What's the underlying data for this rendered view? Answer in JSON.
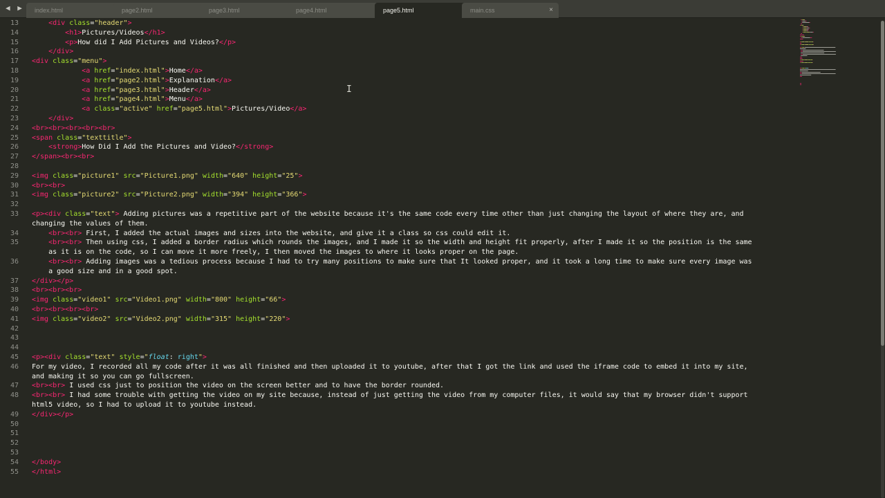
{
  "tabs": [
    {
      "label": "index.html",
      "close": "●",
      "active": false
    },
    {
      "label": "page2.html",
      "close": "●",
      "active": false
    },
    {
      "label": "page3.html",
      "close": "×",
      "active": false
    },
    {
      "label": "page4.html",
      "close": "×",
      "active": false
    },
    {
      "label": "page5.html",
      "close": "×",
      "active": true
    },
    {
      "label": "main.css",
      "close": "×",
      "active": false
    }
  ],
  "nav_arrows": "◀ ▶",
  "line_numbers": [
    "13",
    "14",
    "15",
    "16",
    "17",
    "18",
    "19",
    "20",
    "21",
    "22",
    "23",
    "24",
    "25",
    "26",
    "27",
    "28",
    "29",
    "30",
    "31",
    "32",
    "33",
    "",
    "34",
    "35",
    "",
    "36",
    "",
    "37",
    "38",
    "39",
    "40",
    "41",
    "42",
    "43",
    "44",
    "45",
    "46",
    "",
    "47",
    "48",
    "",
    "49",
    "50",
    "51",
    "52",
    "53",
    "54",
    "55"
  ],
  "code": [
    [
      [
        "p",
        "    "
      ],
      [
        "t",
        "<div"
      ],
      [
        "a",
        " class"
      ],
      [
        "p",
        "="
      ],
      [
        "s",
        "\"header\""
      ],
      [
        "t",
        ">"
      ]
    ],
    [
      [
        "p",
        "        "
      ],
      [
        "t",
        "<h1"
      ],
      [
        "t",
        ">"
      ],
      [
        "p",
        "Pictures/Videos"
      ],
      [
        "t",
        "</h1>"
      ]
    ],
    [
      [
        "p",
        "        "
      ],
      [
        "t",
        "<p"
      ],
      [
        "t",
        ">"
      ],
      [
        "p",
        "How did I Add Pictures and Videos?"
      ],
      [
        "t",
        "</p>"
      ]
    ],
    [
      [
        "p",
        "    "
      ],
      [
        "t",
        "</div>"
      ]
    ],
    [
      [
        "t",
        "<div"
      ],
      [
        "a",
        " class"
      ],
      [
        "p",
        "="
      ],
      [
        "s",
        "\"menu\""
      ],
      [
        "t",
        ">"
      ]
    ],
    [
      [
        "p",
        "            "
      ],
      [
        "t",
        "<a"
      ],
      [
        "a",
        " href"
      ],
      [
        "p",
        "="
      ],
      [
        "s",
        "\"index.html\""
      ],
      [
        "t",
        ">"
      ],
      [
        "p",
        "Home"
      ],
      [
        "t",
        "</a>"
      ]
    ],
    [
      [
        "p",
        "            "
      ],
      [
        "t",
        "<a"
      ],
      [
        "a",
        " href"
      ],
      [
        "p",
        "="
      ],
      [
        "s",
        "\"page2.html\""
      ],
      [
        "t",
        ">"
      ],
      [
        "p",
        "Explanation"
      ],
      [
        "t",
        "</a>"
      ]
    ],
    [
      [
        "p",
        "            "
      ],
      [
        "t",
        "<a"
      ],
      [
        "a",
        " href"
      ],
      [
        "p",
        "="
      ],
      [
        "s",
        "\"page3.html\""
      ],
      [
        "t",
        ">"
      ],
      [
        "p",
        "Header"
      ],
      [
        "t",
        "</a>"
      ]
    ],
    [
      [
        "p",
        "            "
      ],
      [
        "t",
        "<a"
      ],
      [
        "a",
        " href"
      ],
      [
        "p",
        "="
      ],
      [
        "s",
        "\"page4.html\""
      ],
      [
        "t",
        ">"
      ],
      [
        "p",
        "Menu"
      ],
      [
        "t",
        "</a>"
      ]
    ],
    [
      [
        "p",
        "            "
      ],
      [
        "t",
        "<a"
      ],
      [
        "a",
        " class"
      ],
      [
        "p",
        "="
      ],
      [
        "s",
        "\"active\""
      ],
      [
        "a",
        " href"
      ],
      [
        "p",
        "="
      ],
      [
        "s",
        "\"page5.html\""
      ],
      [
        "t",
        ">"
      ],
      [
        "p",
        "Pictures/Video"
      ],
      [
        "t",
        "</a>"
      ]
    ],
    [
      [
        "p",
        "    "
      ],
      [
        "t",
        "</div>"
      ]
    ],
    [
      [
        "t",
        "<br><br><br><br><br>"
      ]
    ],
    [
      [
        "t",
        "<span"
      ],
      [
        "a",
        " class"
      ],
      [
        "p",
        "="
      ],
      [
        "s",
        "\"texttitle\""
      ],
      [
        "t",
        ">"
      ]
    ],
    [
      [
        "p",
        "    "
      ],
      [
        "t",
        "<strong"
      ],
      [
        "t",
        ">"
      ],
      [
        "p",
        "How Did I Add the Pictures and Video?"
      ],
      [
        "t",
        "</strong>"
      ]
    ],
    [
      [
        "t",
        "</span><br><br>"
      ]
    ],
    [
      [
        "p",
        ""
      ]
    ],
    [
      [
        "t",
        "<img"
      ],
      [
        "a",
        " class"
      ],
      [
        "p",
        "="
      ],
      [
        "s",
        "\"picture1\""
      ],
      [
        "a",
        " src"
      ],
      [
        "p",
        "="
      ],
      [
        "s",
        "\"Picture1.png\""
      ],
      [
        "a",
        " width"
      ],
      [
        "p",
        "="
      ],
      [
        "s",
        "\"640\""
      ],
      [
        "a",
        " height"
      ],
      [
        "p",
        "="
      ],
      [
        "s",
        "\"25\""
      ],
      [
        "t",
        ">"
      ]
    ],
    [
      [
        "t",
        "<br><br>"
      ]
    ],
    [
      [
        "t",
        "<img"
      ],
      [
        "a",
        " class"
      ],
      [
        "p",
        "="
      ],
      [
        "s",
        "\"picture2\""
      ],
      [
        "a",
        " src"
      ],
      [
        "p",
        "="
      ],
      [
        "s",
        "\"Picture2.png\""
      ],
      [
        "a",
        " width"
      ],
      [
        "p",
        "="
      ],
      [
        "s",
        "\"394\""
      ],
      [
        "a",
        " height"
      ],
      [
        "p",
        "="
      ],
      [
        "s",
        "\"366\""
      ],
      [
        "t",
        ">"
      ]
    ],
    [
      [
        "p",
        ""
      ]
    ],
    [
      [
        "t",
        "<p><div"
      ],
      [
        "a",
        " class"
      ],
      [
        "p",
        "="
      ],
      [
        "s",
        "\"text\""
      ],
      [
        "t",
        ">"
      ],
      [
        "p",
        " Adding pictures was a repetitive part of the website because it's the same code every time other than just changing the layout of where they are, and"
      ]
    ],
    [
      [
        "p",
        "changing the values of them."
      ]
    ],
    [
      [
        "p",
        "    "
      ],
      [
        "t",
        "<br><br>"
      ],
      [
        "p",
        " First, I added the actual images and sizes into the website, and give it a class so css could edit it."
      ]
    ],
    [
      [
        "p",
        "    "
      ],
      [
        "t",
        "<br><br>"
      ],
      [
        "p",
        " Then using css, I added a border radius which rounds the images, and I made it so the width and height fit properly, after I made it so the position is the same"
      ]
    ],
    [
      [
        "p",
        "    as it is on the code, so I can move it more freely, I then moved the images to where it looks proper on the page."
      ]
    ],
    [
      [
        "p",
        "    "
      ],
      [
        "t",
        "<br><br>"
      ],
      [
        "p",
        " Adding images was a tedious process because I had to try many positions to make sure that It looked proper, and it took a long time to make sure every image was"
      ]
    ],
    [
      [
        "p",
        "    a good size and in a good spot."
      ]
    ],
    [
      [
        "t",
        "</div></p>"
      ]
    ],
    [
      [
        "t",
        "<br><br><br>"
      ]
    ],
    [
      [
        "t",
        "<img"
      ],
      [
        "a",
        " class"
      ],
      [
        "p",
        "="
      ],
      [
        "s",
        "\"video1\""
      ],
      [
        "a",
        " src"
      ],
      [
        "p",
        "="
      ],
      [
        "s",
        "\"Video1.png\""
      ],
      [
        "a",
        " width"
      ],
      [
        "p",
        "="
      ],
      [
        "s",
        "\"800\""
      ],
      [
        "a",
        " height"
      ],
      [
        "p",
        "="
      ],
      [
        "s",
        "\"66\""
      ],
      [
        "t",
        ">"
      ]
    ],
    [
      [
        "t",
        "<br><br><br><br>"
      ]
    ],
    [
      [
        "t",
        "<img"
      ],
      [
        "a",
        " class"
      ],
      [
        "p",
        "="
      ],
      [
        "s",
        "\"video2\""
      ],
      [
        "a",
        " src"
      ],
      [
        "p",
        "="
      ],
      [
        "s",
        "\"Video2.png\""
      ],
      [
        "a",
        " width"
      ],
      [
        "p",
        "="
      ],
      [
        "s",
        "\"315\""
      ],
      [
        "a",
        " height"
      ],
      [
        "p",
        "="
      ],
      [
        "s",
        "\"220\""
      ],
      [
        "t",
        ">"
      ]
    ],
    [
      [
        "p",
        ""
      ]
    ],
    [
      [
        "p",
        ""
      ]
    ],
    [
      [
        "p",
        ""
      ]
    ],
    [
      [
        "t",
        "<p><div"
      ],
      [
        "a",
        " class"
      ],
      [
        "p",
        "="
      ],
      [
        "s",
        "\"text\""
      ],
      [
        "a",
        " style"
      ],
      [
        "p",
        "="
      ],
      [
        "s",
        "\""
      ],
      [
        "i",
        "float"
      ],
      [
        "p",
        ": "
      ],
      [
        "k",
        "right"
      ],
      [
        "s",
        "\""
      ],
      [
        "t",
        ">"
      ]
    ],
    [
      [
        "p",
        "For my video, I recorded all my code after it was all finished and then uploaded it to youtube, after that I got the link and used the iframe code to embed it into my site,"
      ]
    ],
    [
      [
        "p",
        "and making it so you can go fullscreen."
      ]
    ],
    [
      [
        "t",
        "<br><br>"
      ],
      [
        "p",
        " I used css just to position the video on the screen better and to have the border rounded."
      ]
    ],
    [
      [
        "t",
        "<br><br>"
      ],
      [
        "p",
        " I had some trouble with getting the video on my site because, instead of just getting the video from my computer files, it would say that my browser didn't support"
      ]
    ],
    [
      [
        "p",
        "html5 video, so I had to upload it to youtube instead."
      ]
    ],
    [
      [
        "t",
        "</div></p>"
      ]
    ],
    [
      [
        "p",
        ""
      ]
    ],
    [
      [
        "p",
        ""
      ]
    ],
    [
      [
        "p",
        ""
      ]
    ],
    [
      [
        "p",
        ""
      ]
    ],
    [
      [
        "t",
        "</body>"
      ]
    ],
    [
      [
        "t",
        "</html>"
      ]
    ]
  ]
}
